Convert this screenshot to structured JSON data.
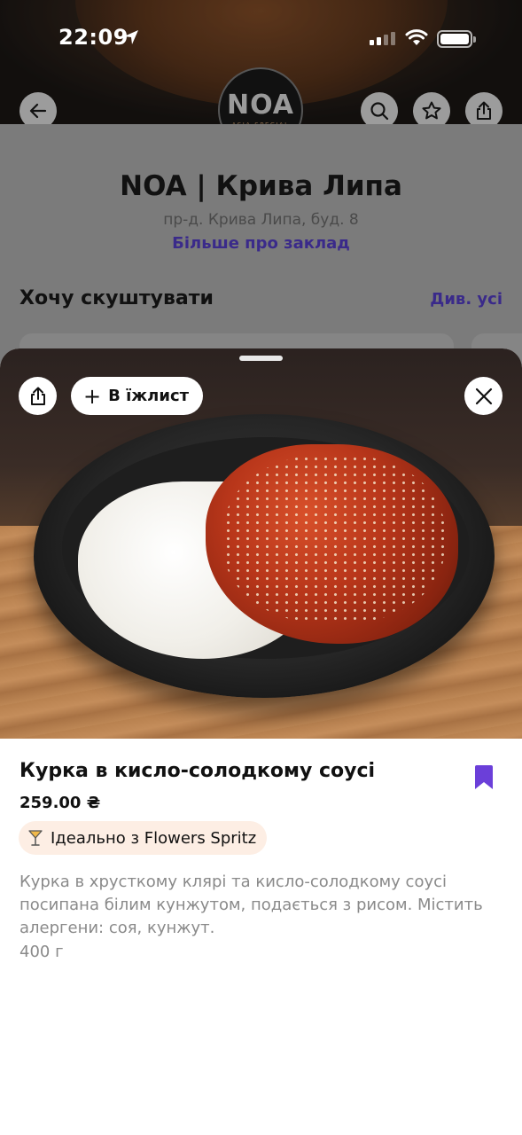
{
  "status_bar": {
    "time": "22:09"
  },
  "restaurant": {
    "logo_main": "NOA",
    "logo_sub": "ASIA SPECIAL",
    "name": "NOA | Крива Липа",
    "address": "пр-д. Крива Липа, буд. 8",
    "about_link": "Більше про заклад"
  },
  "section": {
    "title": "Хочу скуштувати",
    "see_all": "Див. усі"
  },
  "sheet": {
    "add_to_list_label": "В їжлист",
    "dish": {
      "title": "Курка в кисло-солодкому соусі",
      "price": "259.00 ₴",
      "pairing": "Ідеально з Flowers Spritz",
      "description": "Курка в хрусткому клярі та кисло-солодкому соусі посипана білим кунжутом, подається з рисом. Містить алергени: соя, кунжут.",
      "weight": "400 г"
    }
  },
  "icons": {
    "back": "arrow-left-icon",
    "search": "search-icon",
    "favorite": "star-icon",
    "share": "share-icon",
    "close": "close-icon",
    "bookmark": "bookmark-icon",
    "cocktail": "cocktail-icon"
  },
  "colors": {
    "accent": "#6b3fd9",
    "link": "#3a2a8a",
    "pairing_bg": "#fdeee4"
  }
}
